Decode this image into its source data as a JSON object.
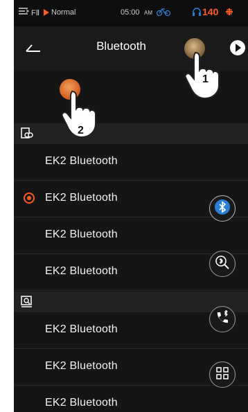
{
  "status_bar": {
    "menu_text": "FⅡ",
    "play_icon": "play-triangle-icon",
    "mode": "Normal",
    "time": "05:00",
    "ampm": "AM",
    "bike_icon": "bicycle-icon",
    "headset_icon": "headset-icon",
    "value": "140"
  },
  "header": {
    "back_icon": "back-icon",
    "title": "Bluetooth",
    "settings_icon": "settings-knob-icon",
    "more_icon": "play-circle-icon"
  },
  "sections": {
    "paired_icon": "paired-devices-icon",
    "search_icon": "search-devices-icon"
  },
  "paired_devices": [
    {
      "name": "EK2 Bluetooth",
      "selected": false
    },
    {
      "name": "EK2 Bluetooth",
      "selected": true
    },
    {
      "name": "EK2 Bluetooth",
      "selected": false
    },
    {
      "name": "EK2 Bluetooth",
      "selected": false
    }
  ],
  "found_devices": [
    {
      "name": "EK2 Bluetooth"
    },
    {
      "name": "EK2 Bluetooth"
    },
    {
      "name": "EK2 Bluetooth"
    }
  ],
  "side_buttons": [
    "bluetooth-icon",
    "bluetooth-search-icon",
    "bluetooth-call-icon",
    "grid-menu-icon"
  ],
  "colors": {
    "accent": "#ff5a1f",
    "bluetooth_blue": "#2a7fd4"
  },
  "callouts": {
    "one": "1",
    "two": "2"
  }
}
